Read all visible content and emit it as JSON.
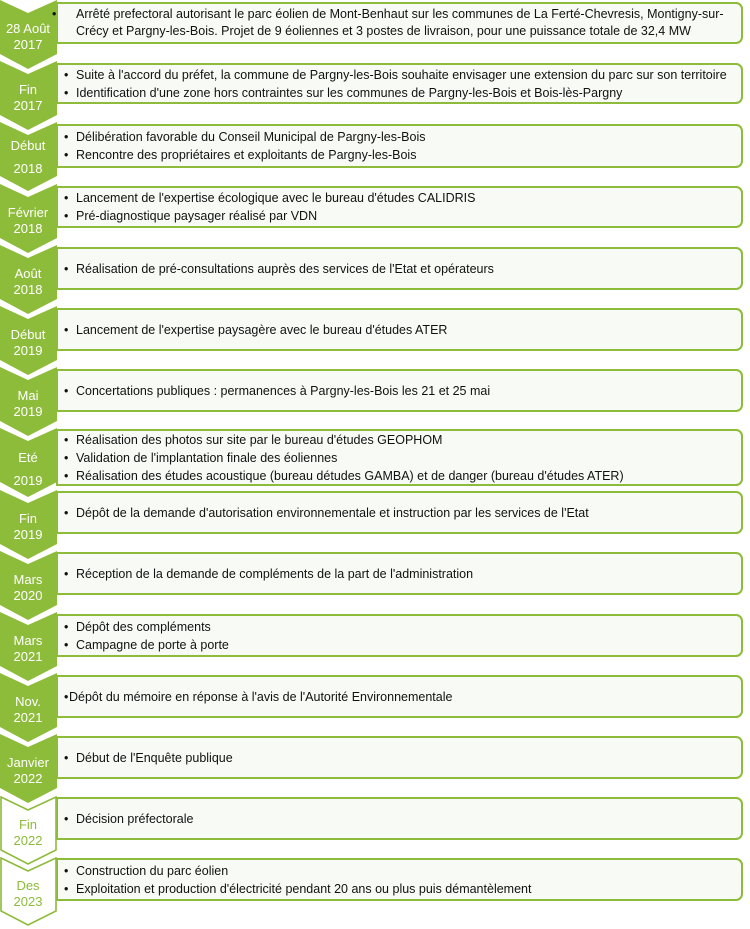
{
  "colors": {
    "accent": "#8dbb3a",
    "box_fill": "#f8fbf5",
    "text": "#111111"
  },
  "timeline": [
    {
      "date_line1": "28 Août",
      "date_line2": "2017",
      "style": "filled",
      "items": [
        "Arrêté prefectoral autorisant le parc éolien de Mont-Benhaut sur les communes de La Ferté-Chevresis, Montigny-sur-Crécy et Pargny-les-Bois. Projet de 9 éoliennes et 3 postes de livraison, pour une puissance totale de 32,4 MW"
      ]
    },
    {
      "date_line1": "Fin",
      "date_line2": "2017",
      "style": "filled",
      "items": [
        "Suite à l'accord du préfet, la commune de Pargny-les-Bois souhaite envisager une extension du parc sur son territoire",
        "Identification d'une zone hors contraintes sur les communes de Pargny-les-Bois et Bois-lès-Pargny"
      ]
    },
    {
      "date_line1": "Début",
      "date_line2": "2018",
      "style": "filled",
      "items": [
        "Délibération favorable du Conseil Municipal de Pargny-les-Bois",
        "Rencontre des propriétaires et exploitants de Pargny-les-Bois"
      ]
    },
    {
      "date_line1": "Février",
      "date_line2": "2018",
      "style": "filled",
      "items": [
        "Lancement de l'expertise écologique avec le bureau d'études CALIDRIS",
        "Pré-diagnostique paysager réalisé par VDN"
      ]
    },
    {
      "date_line1": "Août",
      "date_line2": "2018",
      "style": "filled",
      "items": [
        "Réalisation de pré-consultations auprès des services de l'Etat et opérateurs"
      ]
    },
    {
      "date_line1": "Début",
      "date_line2": "2019",
      "style": "filled",
      "items": [
        "Lancement de l'expertise paysagère avec le bureau d'études ATER"
      ]
    },
    {
      "date_line1": "Mai",
      "date_line2": "2019",
      "style": "filled",
      "items": [
        "Concertations publiques : permanences à Pargny-les-Bois les 21 et 25 mai"
      ]
    },
    {
      "date_line1": "Eté",
      "date_line2": "2019",
      "style": "filled",
      "items": [
        "Réalisation des photos sur site par le bureau d'études GEOPHOM",
        "Validation de l'implantation finale des éoliennes",
        "Réalisation des études acoustique (bureau détudes GAMBA) et de danger (bureau d'études ATER)"
      ]
    },
    {
      "date_line1": "Fin",
      "date_line2": "2019",
      "style": "filled",
      "items": [
        "Dépôt de la demande d'autorisation environnementale et instruction par les services de l'Etat"
      ]
    },
    {
      "date_line1": "Mars",
      "date_line2": "2020",
      "style": "filled",
      "items": [
        "Réception de la demande de compléments de la part de l'administration"
      ]
    },
    {
      "date_line1": "Mars",
      "date_line2": "2021",
      "style": "filled",
      "items": [
        "Dépôt des compléments",
        "Campagne de porte à porte"
      ]
    },
    {
      "date_line1": "Nov.",
      "date_line2": "2021",
      "style": "filled",
      "bullet_tight": true,
      "items": [
        "Dépôt du mémoire en réponse à l'avis de l'Autorité Environnementale"
      ]
    },
    {
      "date_line1": "Janvier",
      "date_line2": "2022",
      "style": "filled",
      "items": [
        "Début de l'Enquête publique"
      ]
    },
    {
      "date_line1": "Fin",
      "date_line2": "2022",
      "style": "outline",
      "items": [
        "Décision préfectorale"
      ]
    },
    {
      "date_line1": "Des",
      "date_line2": "2023",
      "style": "outline",
      "items": [
        "Construction du parc éolien",
        "Exploitation et production d'électricité pendant 20 ans ou plus puis démantèlement"
      ]
    }
  ]
}
